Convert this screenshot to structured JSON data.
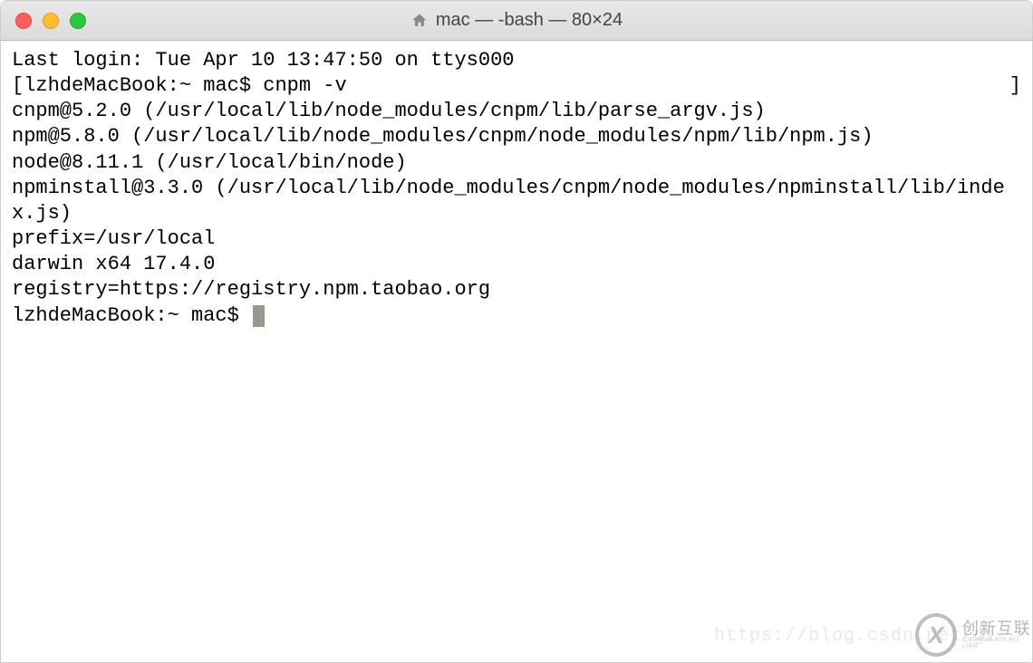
{
  "titlebar": {
    "title": "mac — -bash — 80×24"
  },
  "terminal": {
    "lines": [
      {
        "text": "Last login: Tue Apr 10 13:47:50 on ttys000",
        "bracketed": false,
        "cursor": false
      },
      {
        "text": "lzhdeMacBook:~ mac$ cnpm -v",
        "bracketed": true,
        "cursor": false
      },
      {
        "text": "cnpm@5.2.0 (/usr/local/lib/node_modules/cnpm/lib/parse_argv.js)",
        "bracketed": false,
        "cursor": false
      },
      {
        "text": "npm@5.8.0 (/usr/local/lib/node_modules/cnpm/node_modules/npm/lib/npm.js)",
        "bracketed": false,
        "cursor": false
      },
      {
        "text": "node@8.11.1 (/usr/local/bin/node)",
        "bracketed": false,
        "cursor": false
      },
      {
        "text": "npminstall@3.3.0 (/usr/local/lib/node_modules/cnpm/node_modules/npminstall/lib/index.js)",
        "bracketed": false,
        "cursor": false
      },
      {
        "text": "prefix=/usr/local",
        "bracketed": false,
        "cursor": false
      },
      {
        "text": "darwin x64 17.4.0",
        "bracketed": false,
        "cursor": false
      },
      {
        "text": "registry=https://registry.npm.taobao.org",
        "bracketed": false,
        "cursor": false
      },
      {
        "text": "lzhdeMacBook:~ mac$ ",
        "bracketed": false,
        "cursor": true
      }
    ]
  },
  "watermark": {
    "url": "https://blog.csdn.net/gi",
    "logo_cn": "创新互联",
    "logo_en": "CHUANG XIN HU LIAN"
  }
}
